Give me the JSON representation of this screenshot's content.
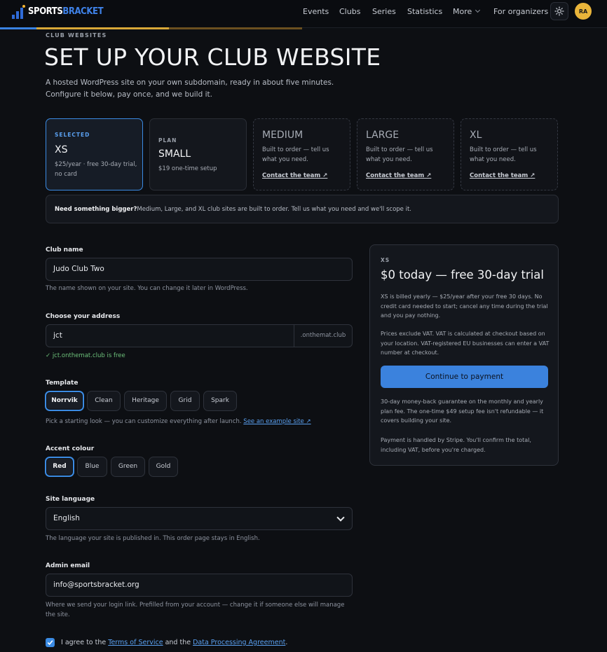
{
  "brand": {
    "part1": "SPORTS",
    "part2": "BRACKET"
  },
  "nav": {
    "events": "Events",
    "clubs": "Clubs",
    "series": "Series",
    "statistics": "Statistics",
    "more": "More",
    "organizers": "For organizers",
    "avatar_initials": "RA"
  },
  "steps": {
    "completed_fraction": 0.12,
    "current_fraction": 0.56
  },
  "header": {
    "eyebrow": "CLUB WEBSITES",
    "title": "SET UP YOUR CLUB WEBSITE",
    "intro": "A hosted WordPress site on your own subdomain, ready in about five minutes. Configure it below, pay once, and we build it."
  },
  "plans": [
    {
      "tag": "SELECTED",
      "name": "XS",
      "desc": "$25/year · free 30-day trial, no card"
    },
    {
      "tag": "PLAN",
      "name": "SMALL",
      "desc": "$19 one-time setup"
    },
    {
      "name": "MEDIUM",
      "desc": "Built to order — tell us what you need.",
      "link": "Contact the team ↗"
    },
    {
      "name": "LARGE",
      "desc": "Built to order — tell us what you need.",
      "link": "Contact the team ↗"
    },
    {
      "name": "XL",
      "desc": "Built to order — tell us what you need.",
      "link": "Contact the team ↗"
    }
  ],
  "bigger": {
    "bold": "Need something bigger?",
    "text": "Medium, Large, and XL club sites are built to order. Tell us what you need and we'll scope it."
  },
  "form": {
    "club_name": {
      "label": "Club name",
      "value": "Judo Club Two",
      "help": "The name shown on your site. You can change it later in WordPress."
    },
    "address": {
      "label": "Choose your address",
      "value": "jct",
      "suffix": ".onthemat.club",
      "status": "✓ jct.onthemat.club is free"
    },
    "template": {
      "label": "Template",
      "options": [
        "Norrvik",
        "Clean",
        "Heritage",
        "Grid",
        "Spark"
      ],
      "selected": "Norrvik",
      "help": "Pick a starting look — you can customize everything after launch.",
      "example_link": "See an example site ↗"
    },
    "accent": {
      "label": "Accent colour",
      "options": [
        "Red",
        "Blue",
        "Green",
        "Gold"
      ],
      "selected": "Red"
    },
    "language": {
      "label": "Site language",
      "value": "English",
      "help": "The language your site is published in. This order page stays in English."
    },
    "admin_email": {
      "label": "Admin email",
      "value": "info@sportsbracket.org",
      "help": "Where we send your login link. Prefilled from your account — change it if someone else will manage the site."
    },
    "agree": {
      "checked": true,
      "prefix": "I agree to the",
      "tos": "Terms of Service",
      "and": "and the",
      "dpa": "Data Processing Agreement",
      "suffix": "."
    }
  },
  "summary": {
    "tag": "XS",
    "title": "$0 today — free 30-day trial",
    "billing": "XS is billed yearly — $25/year after your free 30 days. No credit card needed to start; cancel any time during the trial and you pay nothing.",
    "vat": "Prices exclude VAT. VAT is calculated at checkout based on your location. VAT-registered EU businesses can enter a VAT number at checkout.",
    "button": "Continue to payment",
    "guarantee": "30-day money-back guarantee on the monthly and yearly plan fee. The one-time $49 setup fee isn't refundable — it covers building your site.",
    "stripe": "Payment is handled by Stripe. You'll confirm the total, including VAT, before you're charged."
  }
}
